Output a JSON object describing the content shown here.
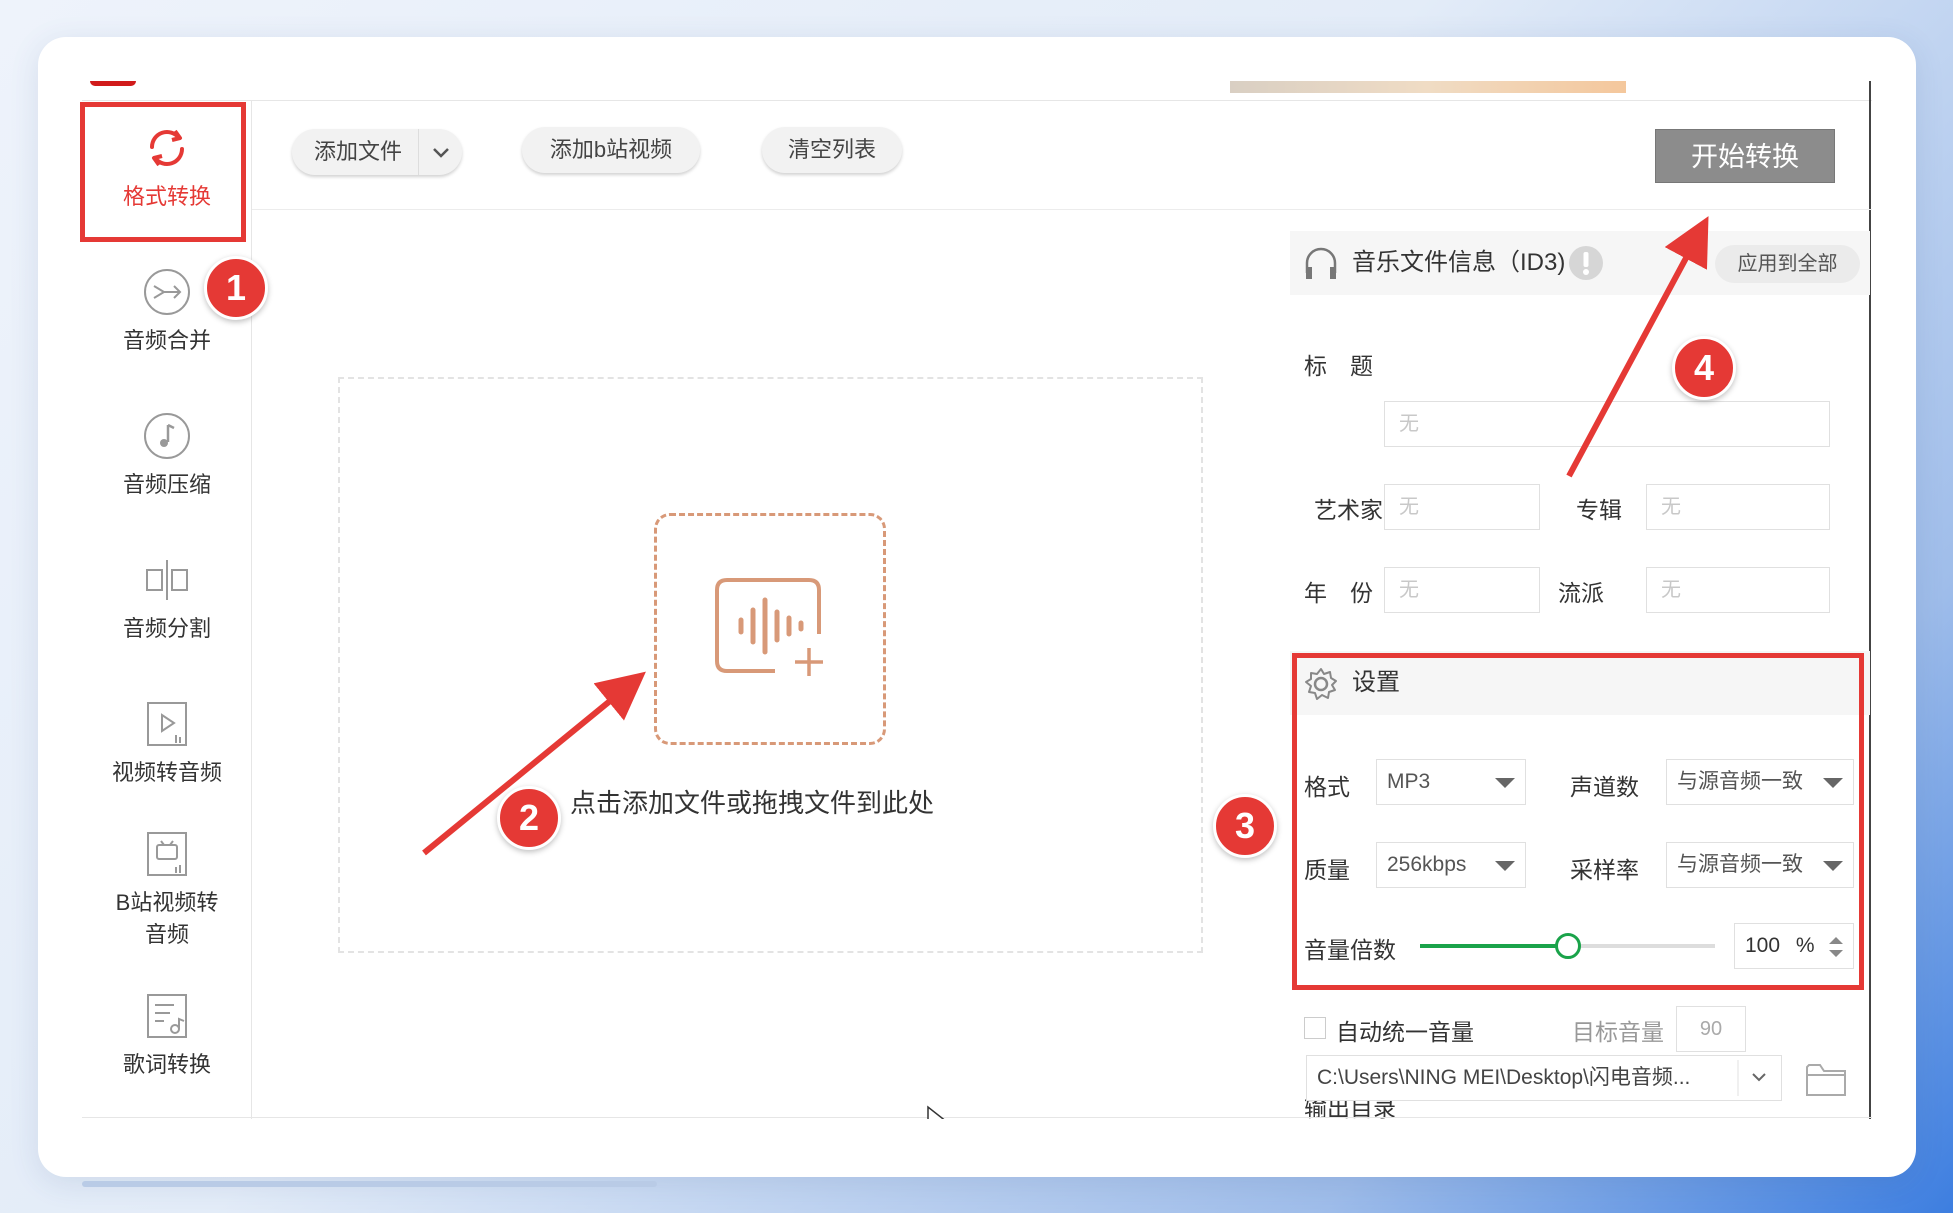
{
  "sidebar": {
    "items": [
      {
        "label": "格式转换",
        "icon": "refresh-icon",
        "active": true
      },
      {
        "label": "音频合并",
        "icon": "merge-icon"
      },
      {
        "label": "音频压缩",
        "icon": "music-note-icon"
      },
      {
        "label": "音频分割",
        "icon": "split-icon"
      },
      {
        "label": "视频转音频",
        "icon": "video-icon"
      },
      {
        "label": "B站视频转\n音频",
        "label_line1": "B站视频转",
        "label_line2": "音频",
        "icon": "bilibili-tv-icon"
      },
      {
        "label": "歌词转换",
        "icon": "lyrics-icon"
      }
    ]
  },
  "toolbar": {
    "add_file": "添加文件",
    "add_bilibili": "添加b站视频",
    "clear_list": "清空列表",
    "start": "开始转换"
  },
  "dropzone": {
    "hint": "点击添加文件或拖拽文件到此处"
  },
  "id3": {
    "header": "音乐文件信息（ID3)",
    "apply_all": "应用到全部",
    "title_label": "标　题",
    "artist_label": "艺术家",
    "album_label": "专辑",
    "year_label": "年　份",
    "genre_label": "流派",
    "placeholder": "无"
  },
  "settings": {
    "header": "设置",
    "format_label": "格式",
    "format_value": "MP3",
    "channels_label": "声道数",
    "channels_value": "与源音频一致",
    "quality_label": "质量",
    "quality_value": "256kbps",
    "samplerate_label": "采样率",
    "samplerate_value": "与源音频一致",
    "volume_label": "音量倍数",
    "volume_value": "100",
    "volume_unit": "%",
    "volume_fraction": 0.5,
    "auto_volume_label": "自动统一音量",
    "target_volume_label": "目标音量",
    "target_volume_value": "90"
  },
  "output": {
    "label": "输出目录",
    "path": "C:\\Users\\NING MEI\\Desktop\\闪电音频..."
  },
  "annotations": {
    "badges": [
      "1",
      "2",
      "3",
      "4"
    ],
    "color": "#e53935"
  },
  "colors": {
    "accent": "#e53935",
    "slider": "#1aa34a",
    "start_button": "#8c8c8c"
  }
}
